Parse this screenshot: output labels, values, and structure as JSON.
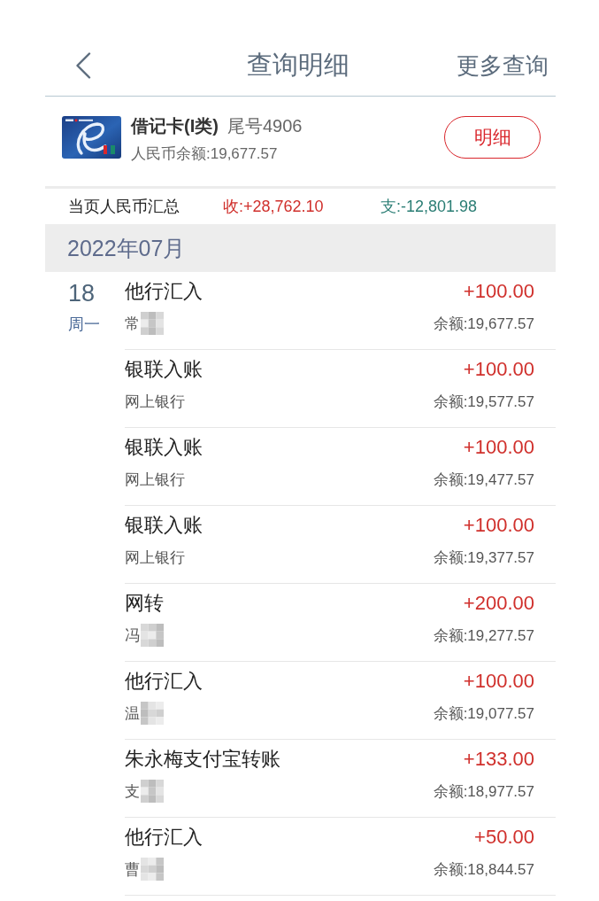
{
  "header": {
    "title": "查询明细",
    "more": "更多查询"
  },
  "card": {
    "name": "借记卡(I类)",
    "tail": "尾号4906",
    "balance": "人民币余额:19,677.57",
    "detail_button": "明细"
  },
  "summary": {
    "label": "当页人民币汇总",
    "income": "收:+28,762.10",
    "expense": "支:-12,801.98"
  },
  "months": [
    {
      "month": "2022年07月",
      "days": [
        {
          "day": "18",
          "weekday": "周一",
          "transactions": [
            {
              "title": "他行汇入",
              "counterparty": "常",
              "redacted": true,
              "amount": "+100.00",
              "balance": "余额:19,677.57"
            },
            {
              "title": "银联入账",
              "counterparty": "网上银行",
              "redacted": false,
              "amount": "+100.00",
              "balance": "余额:19,577.57"
            },
            {
              "title": "银联入账",
              "counterparty": "网上银行",
              "redacted": false,
              "amount": "+100.00",
              "balance": "余额:19,477.57"
            },
            {
              "title": "银联入账",
              "counterparty": "网上银行",
              "redacted": false,
              "amount": "+100.00",
              "balance": "余额:19,377.57"
            },
            {
              "title": "网转",
              "counterparty": "冯",
              "redacted": true,
              "amount": "+200.00",
              "balance": "余额:19,277.57"
            },
            {
              "title": "他行汇入",
              "counterparty": "温",
              "redacted": true,
              "amount": "+100.00",
              "balance": "余额:19,077.57"
            },
            {
              "title": "朱永梅支付宝转账",
              "counterparty": "支",
              "redacted": true,
              "amount": "+133.00",
              "balance": "余额:18,977.57"
            },
            {
              "title": "他行汇入",
              "counterparty": "曹",
              "redacted": true,
              "amount": "+50.00",
              "balance": "余额:18,844.57"
            }
          ]
        }
      ]
    }
  ]
}
